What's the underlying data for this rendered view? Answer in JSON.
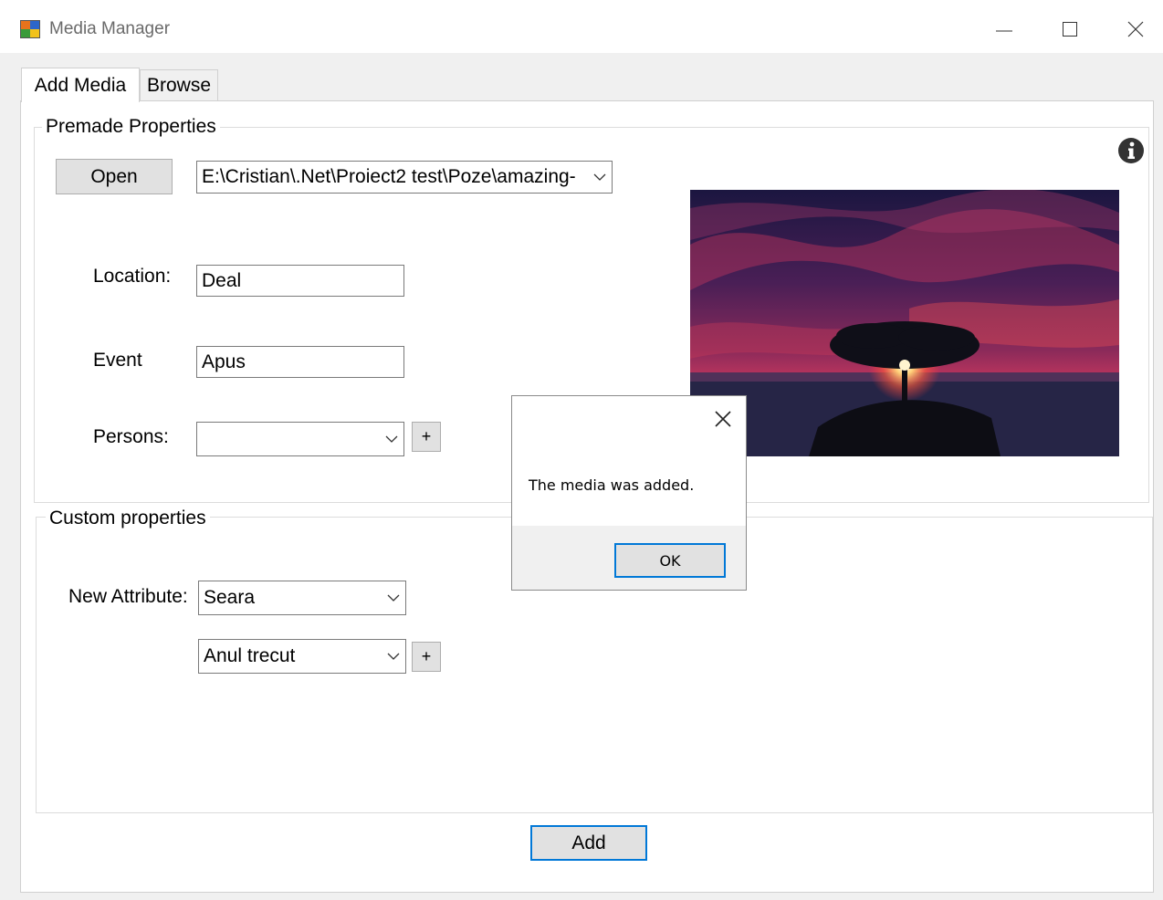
{
  "window": {
    "title": "Media Manager"
  },
  "tabs": [
    {
      "label": "Add Media"
    },
    {
      "label": "Browse"
    }
  ],
  "premade": {
    "legend": "Premade Properties",
    "open_label": "Open",
    "file_path": "E:\\Cristian\\.Net\\Proiect2 test\\Poze\\amazing-",
    "location_label": "Location:",
    "location_value": "Deal",
    "event_label": "Event",
    "event_value": "Apus",
    "persons_label": "Persons:",
    "persons_value": "",
    "plus_label": "+"
  },
  "custom": {
    "legend": "Custom properties",
    "attr_label": "New Attribute:",
    "attr_value": "Seara",
    "attr_value2": "Anul trecut",
    "plus_label": "+"
  },
  "add_label": "Add",
  "dialog": {
    "message": "The media was added.",
    "ok_label": "OK"
  }
}
